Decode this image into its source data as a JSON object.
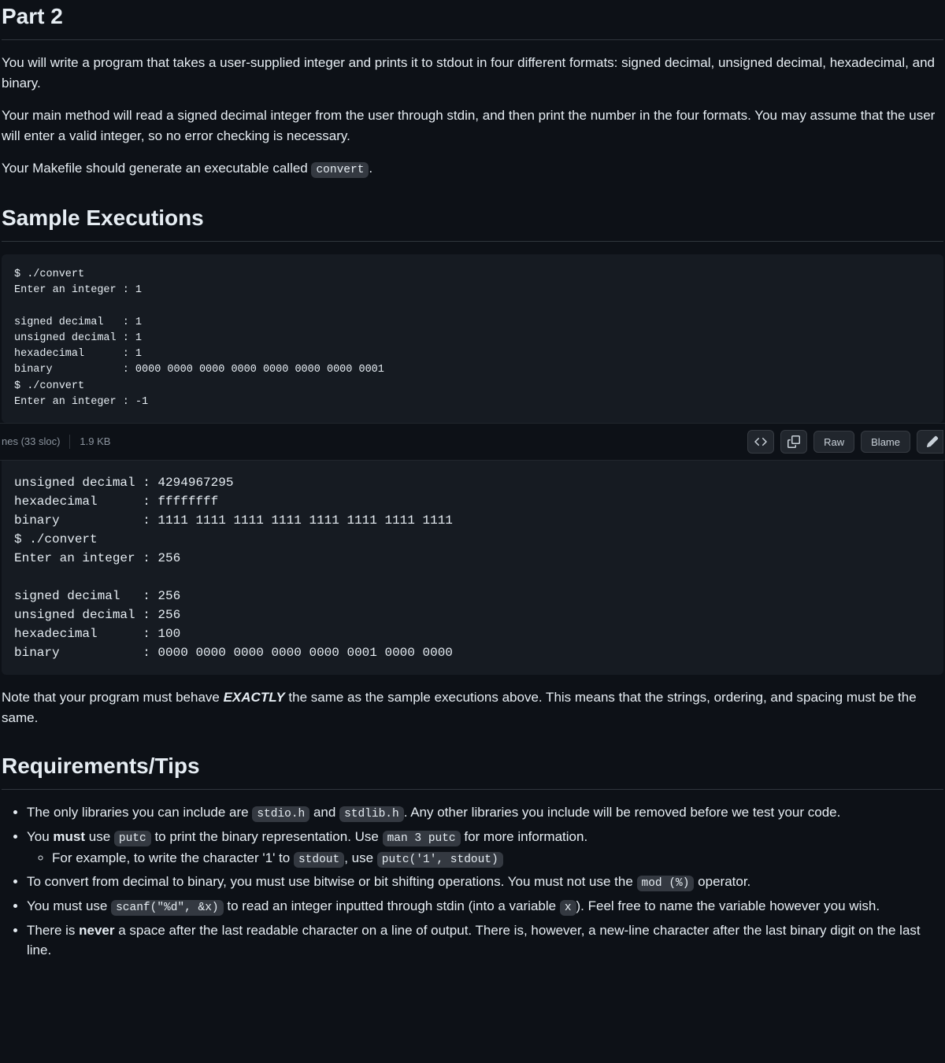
{
  "h_part2": "Part 2",
  "p_intro": "You will write a program that takes a user-supplied integer and prints it to stdout in four different formats: signed decimal, unsigned decimal, hexadecimal, and binary.",
  "p_main": "Your main method will read a signed decimal integer from the user through stdin, and then print the number in the four formats. You may assume that the user will enter a valid integer, so no error checking is necessary.",
  "p_makefile_1": "Your Makefile should generate an executable called ",
  "code_convert": "convert",
  "p_makefile_2": ".",
  "h_sample": "Sample Executions",
  "code_block_1": "$ ./convert\nEnter an integer : 1\n\nsigned decimal   : 1\nunsigned decimal : 1\nhexadecimal      : 1\nbinary           : 0000 0000 0000 0000 0000 0000 0000 0001\n$ ./convert\nEnter an integer : -1",
  "toolbar": {
    "lines": "nes (33 sloc)",
    "size": "1.9 KB",
    "raw": "Raw",
    "blame": "Blame"
  },
  "code_block_2": "unsigned decimal : 4294967295\nhexadecimal      : ffffffff\nbinary           : 1111 1111 1111 1111 1111 1111 1111 1111\n$ ./convert\nEnter an integer : 256\n\nsigned decimal   : 256\nunsigned decimal : 256\nhexadecimal      : 100\nbinary           : 0000 0000 0000 0000 0000 0001 0000 0000",
  "p_note_1": "Note that your program must behave ",
  "p_note_em": "EXACTLY",
  "p_note_2": " the same as the sample executions above. This means that the strings, ordering, and spacing must be the same.",
  "h_req": "Requirements/Tips",
  "req": {
    "r1_a": "The only libraries you can include are ",
    "r1_c1": "stdio.h",
    "r1_b": " and ",
    "r1_c2": "stdlib.h",
    "r1_c": ". Any other libraries you include will be removed before we test your code.",
    "r2_a": "You ",
    "r2_s": "must",
    "r2_b": " use ",
    "r2_c1": "putc",
    "r2_c": " to print the binary representation. Use ",
    "r2_c2": "man 3 putc",
    "r2_d": " for more information.",
    "r2_sub_a": "For example, to write the character '1' to ",
    "r2_sub_c1": "stdout",
    "r2_sub_b": ", use ",
    "r2_sub_c2": "putc('1', stdout)",
    "r3_a": "To convert from decimal to binary, you must use bitwise or bit shifting operations. You must not use the ",
    "r3_c1": "mod (%)",
    "r3_b": " operator.",
    "r4_a": "You must use ",
    "r4_c1": "scanf(\"%d\", &x)",
    "r4_b": " to read an integer inputted through stdin (into a variable ",
    "r4_c2": "x",
    "r4_c": "). Feel free to name the variable however you wish.",
    "r5_a": "There is ",
    "r5_s": "never",
    "r5_b": " a space after the last readable character on a line of output. There is, however, a new-line character after the last binary digit on the last line."
  }
}
